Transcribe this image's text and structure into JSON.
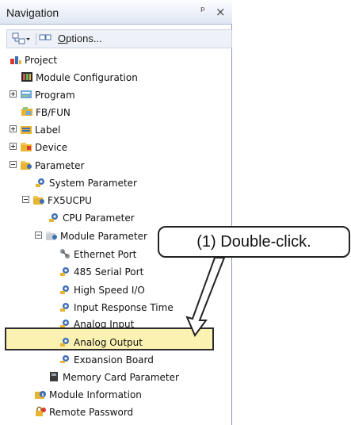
{
  "panel": {
    "title": "Navigation",
    "pin_icon": "pin-icon",
    "close_icon": "close-icon"
  },
  "toolbar": {
    "options_label": "Options...",
    "options_mnemonic": "O",
    "options_rest": "ptions..."
  },
  "tree": {
    "project": "Project",
    "module_configuration": "Module Configuration",
    "program": "Program",
    "fb_fun": "FB/FUN",
    "label": "Label",
    "device": "Device",
    "parameter": "Parameter",
    "system_parameter": "System Parameter",
    "fx5ucpu": "FX5UCPU",
    "cpu_parameter": "CPU Parameter",
    "module_parameter": "Module Parameter",
    "ethernet_port": "Ethernet Port",
    "serial_port": "485 Serial Port",
    "high_speed_io": "High Speed I/O",
    "input_response_time": "Input Response Time",
    "analog_input": "Analog Input",
    "analog_output": "Analog Output",
    "expansion_board": "Expansion Board",
    "memory_card_parameter": "Memory Card Parameter",
    "module_information": "Module Information",
    "remote_password": "Remote Password"
  },
  "callout": {
    "text": "(1) Double-click."
  },
  "colors": {
    "selection_fill": "#f7eca0",
    "folder_yellow": "#e8b431",
    "param_blue": "#3a6fb4"
  }
}
